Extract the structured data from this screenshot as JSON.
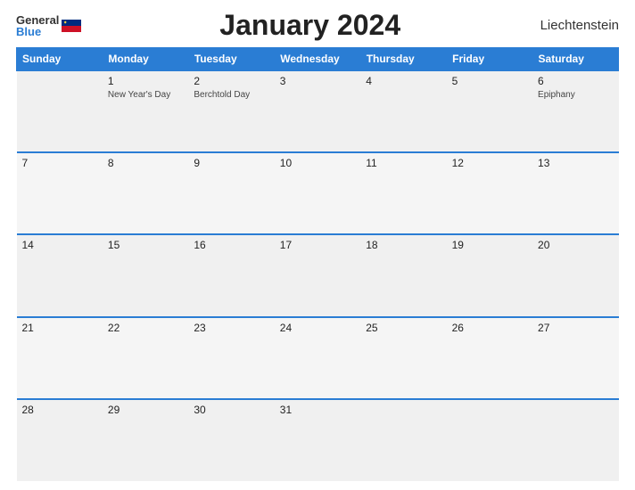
{
  "header": {
    "logo_general": "General",
    "logo_blue": "Blue",
    "title": "January 2024",
    "country": "Liechtenstein"
  },
  "weekdays": [
    "Sunday",
    "Monday",
    "Tuesday",
    "Wednesday",
    "Thursday",
    "Friday",
    "Saturday"
  ],
  "weeks": [
    [
      {
        "day": "",
        "holiday": ""
      },
      {
        "day": "1",
        "holiday": "New Year's Day"
      },
      {
        "day": "2",
        "holiday": "Berchtold Day"
      },
      {
        "day": "3",
        "holiday": ""
      },
      {
        "day": "4",
        "holiday": ""
      },
      {
        "day": "5",
        "holiday": ""
      },
      {
        "day": "6",
        "holiday": "Epiphany"
      }
    ],
    [
      {
        "day": "7",
        "holiday": ""
      },
      {
        "day": "8",
        "holiday": ""
      },
      {
        "day": "9",
        "holiday": ""
      },
      {
        "day": "10",
        "holiday": ""
      },
      {
        "day": "11",
        "holiday": ""
      },
      {
        "day": "12",
        "holiday": ""
      },
      {
        "day": "13",
        "holiday": ""
      }
    ],
    [
      {
        "day": "14",
        "holiday": ""
      },
      {
        "day": "15",
        "holiday": ""
      },
      {
        "day": "16",
        "holiday": ""
      },
      {
        "day": "17",
        "holiday": ""
      },
      {
        "day": "18",
        "holiday": ""
      },
      {
        "day": "19",
        "holiday": ""
      },
      {
        "day": "20",
        "holiday": ""
      }
    ],
    [
      {
        "day": "21",
        "holiday": ""
      },
      {
        "day": "22",
        "holiday": ""
      },
      {
        "day": "23",
        "holiday": ""
      },
      {
        "day": "24",
        "holiday": ""
      },
      {
        "day": "25",
        "holiday": ""
      },
      {
        "day": "26",
        "holiday": ""
      },
      {
        "day": "27",
        "holiday": ""
      }
    ],
    [
      {
        "day": "28",
        "holiday": ""
      },
      {
        "day": "29",
        "holiday": ""
      },
      {
        "day": "30",
        "holiday": ""
      },
      {
        "day": "31",
        "holiday": ""
      },
      {
        "day": "",
        "holiday": ""
      },
      {
        "day": "",
        "holiday": ""
      },
      {
        "day": "",
        "holiday": ""
      }
    ]
  ]
}
